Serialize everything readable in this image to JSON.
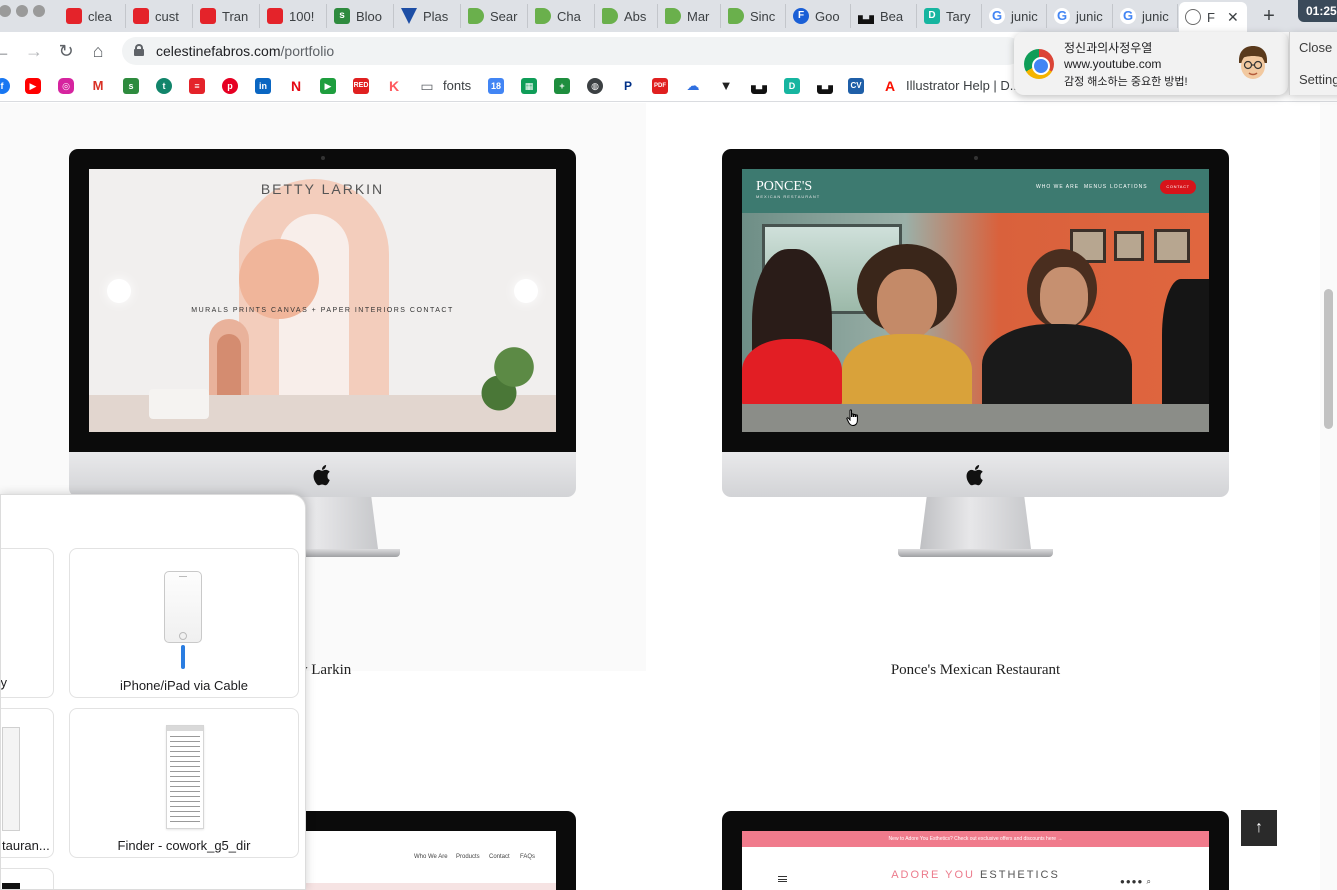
{
  "browser": {
    "clock": "01:25",
    "tabs": [
      {
        "label": "clea",
        "icon": "todoist-icon"
      },
      {
        "label": "cust",
        "icon": "todoist-icon"
      },
      {
        "label": "Tran",
        "icon": "todoist-icon"
      },
      {
        "label": "100!",
        "icon": "todoist-icon"
      },
      {
        "label": "Bloo",
        "icon": "shopify-icon"
      },
      {
        "label": "Plas",
        "icon": "vuetify-icon"
      },
      {
        "label": "Sear",
        "icon": "tag-icon"
      },
      {
        "label": "Cha",
        "icon": "tag-icon"
      },
      {
        "label": "Abs",
        "icon": "tag-icon"
      },
      {
        "label": "Mar",
        "icon": "tag-icon"
      },
      {
        "label": "Sinc",
        "icon": "tag-icon"
      },
      {
        "label": "Goo",
        "icon": "f-icon"
      },
      {
        "label": "Bea",
        "icon": "unsplash-icon"
      },
      {
        "label": "Tary",
        "icon": "d-icon"
      },
      {
        "label": "junic",
        "icon": "google-icon"
      },
      {
        "label": "junic",
        "icon": "google-icon"
      },
      {
        "label": "junic",
        "icon": "google-icon"
      },
      {
        "label": "F",
        "icon": "globe-icon",
        "active": true
      }
    ],
    "new_tab": "+",
    "url_domain": "celestinefabros.com",
    "url_path": "/portfolio",
    "bookmarks": {
      "fonts": "fonts",
      "calendar_day": "18",
      "cv": "CV",
      "illustrator": "Illustrator Help | D..."
    }
  },
  "notification": {
    "title": "정신과의사정우열",
    "site": "www.youtube.com",
    "body": "감정 해소하는 중요한 방법!",
    "close": "Close",
    "settings": "Settings"
  },
  "portfolio": {
    "item1": {
      "logo": "BETTY LARKIN",
      "menu": "MURALS   PRINTS   CANVAS + PAPER   INTERIORS   CONTACT",
      "caption_fragment": "y Larkin"
    },
    "item2": {
      "logo": "PONCE'S",
      "tagline": "MEXICAN RESTAURANT",
      "nav": [
        "WHO WE ARE",
        "MENUS",
        "LOCATIONS"
      ],
      "contact": "CONTACT",
      "caption": "Ponce's Mexican Restaurant"
    },
    "item3": {
      "nav": [
        "Who We Are",
        "Products",
        "Contact",
        "FAQs"
      ]
    },
    "item4": {
      "banner": "New to Adore You Esthetics? Check out exclusive offers and discounts here →",
      "logo_pink": "ADORE YOU",
      "logo_rest": " ESTHETICS",
      "icons": "●●●● ⌕"
    },
    "scroll_top": "↑"
  },
  "airdrop": {
    "tiles": [
      {
        "label": "y"
      },
      {
        "label": "iPhone/iPad via Cable"
      },
      {
        "label": "tauran..."
      },
      {
        "label": "Finder - cowork_g5_dir"
      }
    ]
  }
}
